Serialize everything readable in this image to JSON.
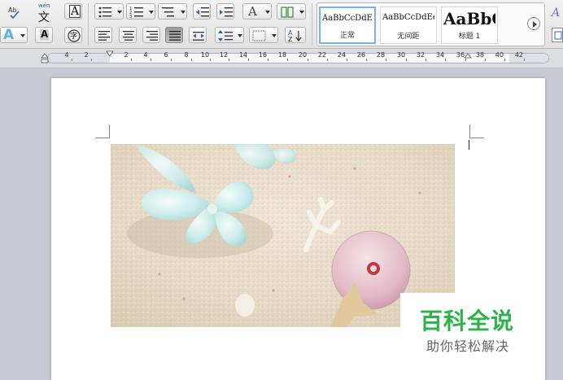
{
  "ribbon": {
    "styles": [
      {
        "sample": "AaBbCcDdEe",
        "name": "正常",
        "active": true
      },
      {
        "sample": "AaBbCcDdEe",
        "name": "无间距",
        "active": false
      },
      {
        "sample": "AaBbC",
        "name": "标题 1",
        "active": false
      }
    ],
    "button_glyphs": {
      "char_border": "A",
      "char_shading": "A",
      "text_effects": "A",
      "phonetic": "文",
      "phonetic_top": "wén",
      "font_color": "A",
      "enclose": "字"
    }
  },
  "ruler": {
    "labels": [
      "4",
      "2",
      "2",
      "4",
      "6",
      "8",
      "10",
      "12",
      "14",
      "16",
      "18",
      "20",
      "22",
      "24",
      "26",
      "28",
      "30",
      "32",
      "34",
      "36",
      "38",
      "40",
      "42"
    ]
  },
  "document": {
    "image_description_icon": "beach-photo"
  },
  "watermark": {
    "title": "百科全说",
    "subtitle": "助你轻松解决"
  },
  "colors": {
    "watermark_green": "#2db34a",
    "active_style_border": "#7fb0e6"
  }
}
